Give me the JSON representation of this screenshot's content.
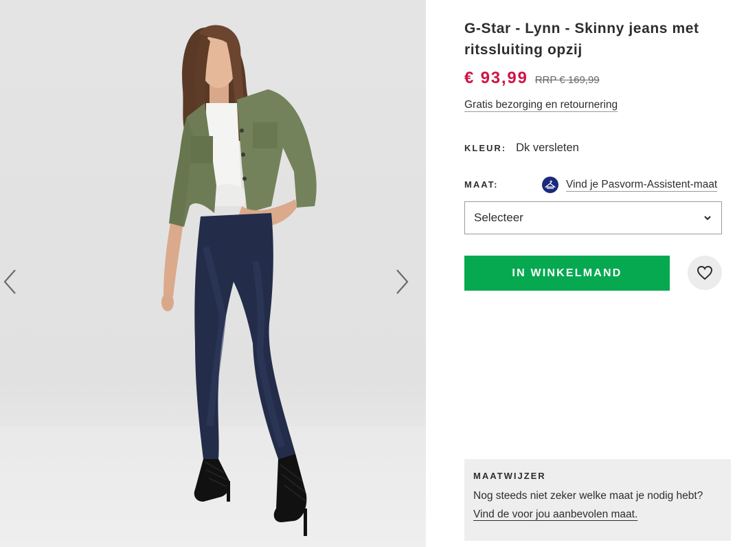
{
  "product": {
    "title": "G-Star - Lynn - Skinny jeans met ritssluiting opzij",
    "price": "€ 93,99",
    "rrp": "RRP € 169,99",
    "delivery_link": "Gratis bezorging en retournering",
    "price_color": "#d01345"
  },
  "colour": {
    "label": "KLEUR:",
    "value": "Dk versleten"
  },
  "size": {
    "label": "MAAT:",
    "fit_assistant_link": "Vind je Pasvorm-Assistent-maat",
    "fit_icon": "hanger-icon",
    "select_value": "Selecteer"
  },
  "actions": {
    "add_to_bag": "IN WINKELMAND",
    "add_to_bag_color": "#06a950",
    "save_icon": "heart-icon"
  },
  "size_guide": {
    "title": "MAATWIJZER",
    "text": "Nog steeds niet zeker welke maat je nodig hebt?",
    "link": "Vind de voor jou aanbevolen maat."
  },
  "gallery": {
    "prev_icon": "chevron-left-icon",
    "next_icon": "chevron-right-icon",
    "image_alt": "product-photo"
  }
}
